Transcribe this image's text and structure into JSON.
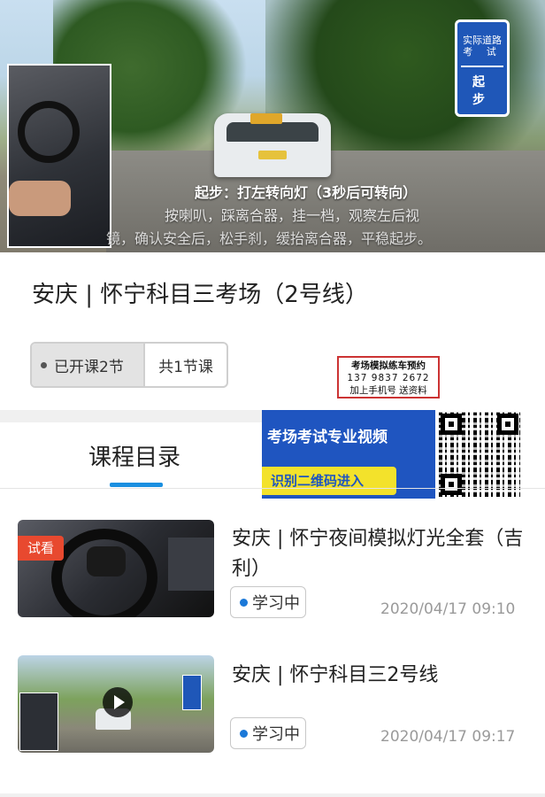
{
  "hero": {
    "sign_top": "实际道路",
    "sign_mid": "考 试",
    "sign_bottom": "起 步",
    "caption_line1": "起步：打左转向灯（3秒后可转向）",
    "caption_line2": "按喇叭，踩离合器，挂一档，观察左后视",
    "caption_line3": "镜，确认安全后，松手刹，缓抬离合器，平稳起步。"
  },
  "course": {
    "title": "安庆 | 怀宁科目三考场（2号线）",
    "opened": "已开课2节",
    "total": "共1节课"
  },
  "ad_small": {
    "line1": "考场模拟练车预约",
    "line2": "137 9837 2672",
    "line3": "加上手机号  送资料"
  },
  "banner": {
    "title": "考场考试专业视频",
    "cta": "识别二维码进入"
  },
  "tab": {
    "label": "课程目录"
  },
  "lessons": [
    {
      "title": "安庆 | 怀宁夜间模拟灯光全套（吉利）",
      "tag": "试看",
      "status": "学习中",
      "date": "2020/04/17 09:10"
    },
    {
      "title": "安庆 | 怀宁科目三2号线",
      "status": "学习中",
      "date": "2020/04/17 09:17"
    }
  ],
  "colors": {
    "accent": "#1a8fe0",
    "status_dot": "#1a78d8",
    "preview_tag": "#e8492f",
    "banner_blue": "#1f55c0",
    "banner_yellow": "#f3e22b"
  },
  "icons": [
    "play-icon",
    "status-dot-icon"
  ]
}
